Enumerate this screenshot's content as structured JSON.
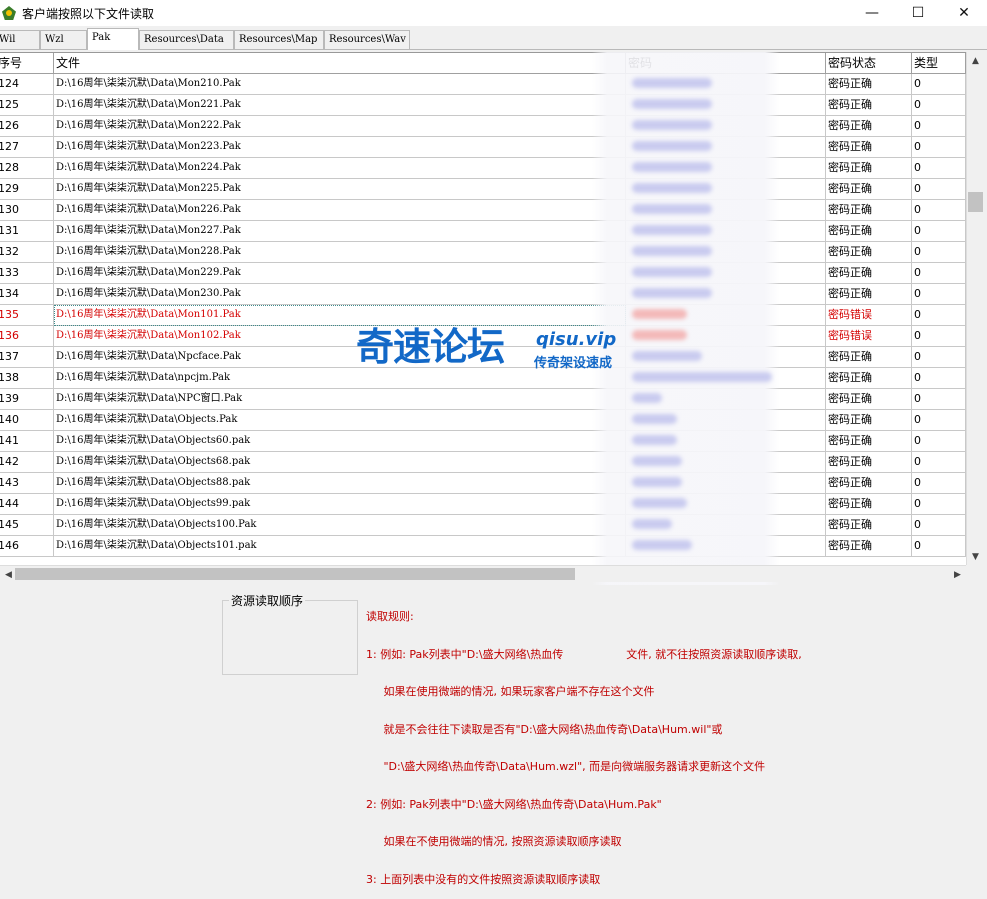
{
  "window": {
    "title": "客户端按照以下文件读取",
    "minimize_glyph": "—",
    "maximize_glyph": "☐",
    "close_glyph": "✕"
  },
  "tabs": [
    {
      "label": "Wil"
    },
    {
      "label": "Wzl"
    },
    {
      "label": "Pak",
      "active": true
    },
    {
      "label": "Resources\\Data"
    },
    {
      "label": "Resources\\Map"
    },
    {
      "label": "Resources\\Wav"
    }
  ],
  "grid": {
    "headers": {
      "index": "序号",
      "file": "文件",
      "password": "密码",
      "status": "密码状态",
      "type": "类型"
    },
    "rows": [
      {
        "index": "124",
        "file": "D:\\16周年\\柒柒沉默\\Data\\Mon210.Pak",
        "status": "密码正确",
        "type": "0",
        "error": false
      },
      {
        "index": "125",
        "file": "D:\\16周年\\柒柒沉默\\Data\\Mon221.Pak",
        "status": "密码正确",
        "type": "0",
        "error": false
      },
      {
        "index": "126",
        "file": "D:\\16周年\\柒柒沉默\\Data\\Mon222.Pak",
        "status": "密码正确",
        "type": "0",
        "error": false
      },
      {
        "index": "127",
        "file": "D:\\16周年\\柒柒沉默\\Data\\Mon223.Pak",
        "status": "密码正确",
        "type": "0",
        "error": false
      },
      {
        "index": "128",
        "file": "D:\\16周年\\柒柒沉默\\Data\\Mon224.Pak",
        "status": "密码正确",
        "type": "0",
        "error": false
      },
      {
        "index": "129",
        "file": "D:\\16周年\\柒柒沉默\\Data\\Mon225.Pak",
        "status": "密码正确",
        "type": "0",
        "error": false
      },
      {
        "index": "130",
        "file": "D:\\16周年\\柒柒沉默\\Data\\Mon226.Pak",
        "status": "密码正确",
        "type": "0",
        "error": false
      },
      {
        "index": "131",
        "file": "D:\\16周年\\柒柒沉默\\Data\\Mon227.Pak",
        "status": "密码正确",
        "type": "0",
        "error": false
      },
      {
        "index": "132",
        "file": "D:\\16周年\\柒柒沉默\\Data\\Mon228.Pak",
        "status": "密码正确",
        "type": "0",
        "error": false
      },
      {
        "index": "133",
        "file": "D:\\16周年\\柒柒沉默\\Data\\Mon229.Pak",
        "status": "密码正确",
        "type": "0",
        "error": false
      },
      {
        "index": "134",
        "file": "D:\\16周年\\柒柒沉默\\Data\\Mon230.Pak",
        "status": "密码正确",
        "type": "0",
        "error": false
      },
      {
        "index": "135",
        "file": "D:\\16周年\\柒柒沉默\\Data\\Mon101.Pak",
        "status": "密码错误",
        "type": "0",
        "error": true
      },
      {
        "index": "136",
        "file": "D:\\16周年\\柒柒沉默\\Data\\Mon102.Pak",
        "status": "密码错误",
        "type": "0",
        "error": true
      },
      {
        "index": "137",
        "file": "D:\\16周年\\柒柒沉默\\Data\\Npcface.Pak",
        "status": "密码正确",
        "type": "0",
        "error": false
      },
      {
        "index": "138",
        "file": "D:\\16周年\\柒柒沉默\\Data\\npcjm.Pak",
        "status": "密码正确",
        "type": "0",
        "error": false
      },
      {
        "index": "139",
        "file": "D:\\16周年\\柒柒沉默\\Data\\NPC窗口.Pak",
        "status": "密码正确",
        "type": "0",
        "error": false
      },
      {
        "index": "140",
        "file": "D:\\16周年\\柒柒沉默\\Data\\Objects.Pak",
        "status": "密码正确",
        "type": "0",
        "error": false
      },
      {
        "index": "141",
        "file": "D:\\16周年\\柒柒沉默\\Data\\Objects60.pak",
        "status": "密码正确",
        "type": "0",
        "error": false
      },
      {
        "index": "142",
        "file": "D:\\16周年\\柒柒沉默\\Data\\Objects68.pak",
        "status": "密码正确",
        "type": "0",
        "error": false
      },
      {
        "index": "143",
        "file": "D:\\16周年\\柒柒沉默\\Data\\Objects88.pak",
        "status": "密码正确",
        "type": "0",
        "error": false
      },
      {
        "index": "144",
        "file": "D:\\16周年\\柒柒沉默\\Data\\Objects99.pak",
        "status": "密码正确",
        "type": "0",
        "error": false
      },
      {
        "index": "145",
        "file": "D:\\16周年\\柒柒沉默\\Data\\Objects100.Pak",
        "status": "密码正确",
        "type": "0",
        "error": false
      },
      {
        "index": "146",
        "file": "D:\\16周年\\柒柒沉默\\Data\\Objects101.pak",
        "status": "密码正确",
        "type": "0",
        "error": false
      }
    ]
  },
  "scrollbars": {
    "up_glyph": "▲",
    "down_glyph": "▼",
    "left_glyph": "◀",
    "right_glyph": "▶"
  },
  "load_order": {
    "label": "资源读取顺序"
  },
  "rules": {
    "lines": [
      "读取规则:",
      "1: 例如: Pak列表中\"D:\\盛大网络\\热血传                  文件, 就不往按照资源读取顺序读取,",
      "     如果在使用微端的情况, 如果玩家客户端不存在这个文件",
      "     就是不会往往下读取是否有\"D:\\盛大网络\\热血传奇\\Data\\Hum.wil\"或",
      "     \"D:\\盛大网络\\热血传奇\\Data\\Hum.wzl\", 而是向微端服务器请求更新这个文件",
      "2: 例如: Pak列表中\"D:\\盛大网络\\热血传奇\\Data\\Hum.Pak\"",
      "     如果在不使用微端的情况, 按照资源读取顺序读取",
      "3: 上面列表中没有的文件按照资源读取顺序读取"
    ]
  },
  "watermark": {
    "brand": "奇速论坛",
    "url": "qisu.vip",
    "tagline": "传奇架设速成"
  },
  "colors": {
    "error": "#d40000",
    "watermark": "#1268c7"
  }
}
